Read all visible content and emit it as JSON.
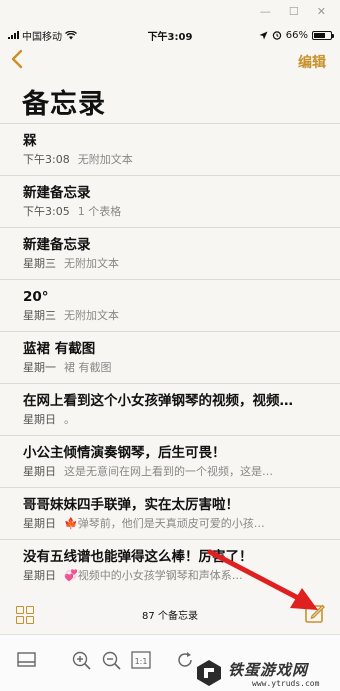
{
  "status_bar": {
    "carrier": "中国移动",
    "time": "下午3:09",
    "battery": "66%"
  },
  "nav": {
    "edit_label": "编辑"
  },
  "page_title": "备忘录",
  "notes": [
    {
      "title": "槑",
      "date": "下午3:08",
      "preview": "无附加文本"
    },
    {
      "title": "新建备忘录",
      "date": "下午3:05",
      "preview": "1 个表格"
    },
    {
      "title": "新建备忘录",
      "date": "星期三",
      "preview": "无附加文本"
    },
    {
      "title": "20°",
      "date": "星期三",
      "preview": "无附加文本"
    },
    {
      "title": "蓝裙 有截图",
      "date": "星期一",
      "preview": "裙 有截图"
    },
    {
      "title": "在网上看到这个小女孩弹钢琴的视频，视频…",
      "date": "星期日",
      "preview": "。"
    },
    {
      "title": "小公主倾情演奏钢琴，后生可畏！",
      "date": "星期日",
      "preview": "这是无意间在网上看到的一个视频，这是…"
    },
    {
      "title": "哥哥妹妹四手联弹，实在太厉害啦！",
      "date": "星期日",
      "preview": "🍁弹琴前，他们是天真顽皮可爱的小孩…"
    },
    {
      "title": "没有五线谱也能弹得这么棒！厉害了！",
      "date": "星期日",
      "preview": "💞视频中的小女孩学钢琴和声体系…"
    }
  ],
  "bottom_toolbar": {
    "note_count": "87 个备忘录"
  },
  "watermark": {
    "text": "铁蛋游戏网",
    "url": "www.ytruds.com"
  },
  "colors": {
    "accent": "#c8912a",
    "annotation_arrow": "#e02020"
  }
}
